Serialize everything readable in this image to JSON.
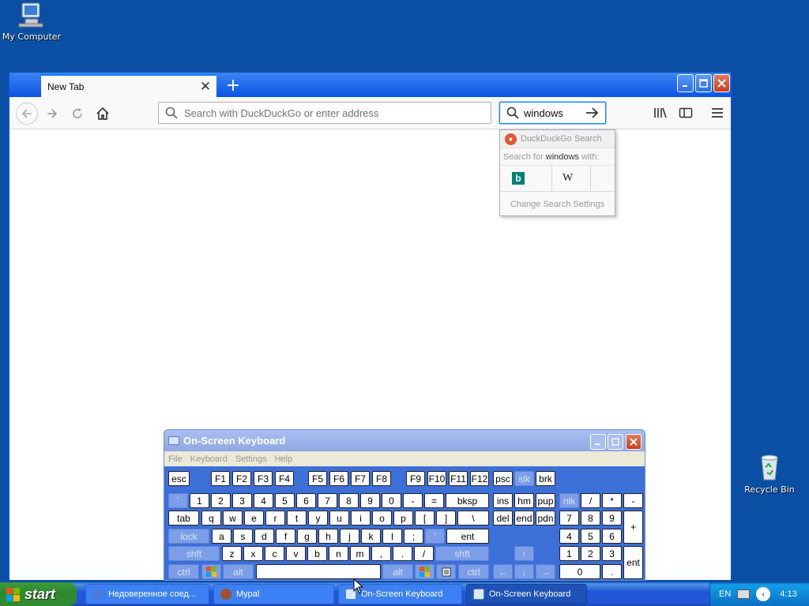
{
  "desktop": {
    "icons": [
      {
        "label": "My Computer"
      },
      {
        "label": "Recycle Bin"
      }
    ]
  },
  "firefox": {
    "tab_title": "New Tab",
    "url_placeholder": "Search with DuckDuckGo or enter address",
    "search_value": "windows",
    "search_popup": {
      "header": "DuckDuckGo Search",
      "search_for_prefix": "Search for",
      "search_for_term": "windows",
      "search_for_suffix": "with:",
      "engines": [
        "bing-icon",
        "wikipedia-icon"
      ],
      "wiki_glyph": "W",
      "settings_label": "Change Search Settings"
    }
  },
  "osk": {
    "title": "On-Screen Keyboard",
    "menu": [
      "File",
      "Keyboard",
      "Settings",
      "Help"
    ],
    "rows": [
      [
        "esc",
        "F1",
        "F2",
        "F3",
        "F4",
        "F5",
        "F6",
        "F7",
        "F8",
        "F9",
        "F10",
        "F11",
        "F12",
        "psc",
        "slk",
        "brk"
      ],
      [
        "`",
        "1",
        "2",
        "3",
        "4",
        "5",
        "6",
        "7",
        "8",
        "9",
        "0",
        "-",
        "=",
        "bksp",
        "ins",
        "hm",
        "pup",
        "nlk",
        "/",
        "*",
        "-"
      ],
      [
        "tab",
        "q",
        "w",
        "e",
        "r",
        "t",
        "y",
        "u",
        "i",
        "o",
        "p",
        "[",
        "]",
        "\\",
        "del",
        "end",
        "pdn",
        "7",
        "8",
        "9",
        "+"
      ],
      [
        "lock",
        "a",
        "s",
        "d",
        "f",
        "g",
        "h",
        "j",
        "k",
        "l",
        ";",
        "'",
        "ent",
        "4",
        "5",
        "6"
      ],
      [
        "shft",
        "z",
        "x",
        "c",
        "v",
        "b",
        "n",
        "m",
        ",",
        ".",
        "/",
        "shft",
        "↑",
        "1",
        "2",
        "3",
        "ent"
      ],
      [
        "ctrl",
        "win",
        "alt",
        "",
        "alt",
        "win",
        "menu",
        "ctrl",
        "←",
        "↓",
        "→",
        "0",
        "."
      ]
    ]
  },
  "taskbar": {
    "start_label": "start",
    "tasks": [
      {
        "label": "Недоверенное соед..."
      },
      {
        "label": "Mypal"
      },
      {
        "label": "On-Screen Keyboard"
      },
      {
        "label": "On-Screen Keyboard"
      }
    ],
    "tray": {
      "lang": "EN",
      "clock": "4:13"
    }
  }
}
